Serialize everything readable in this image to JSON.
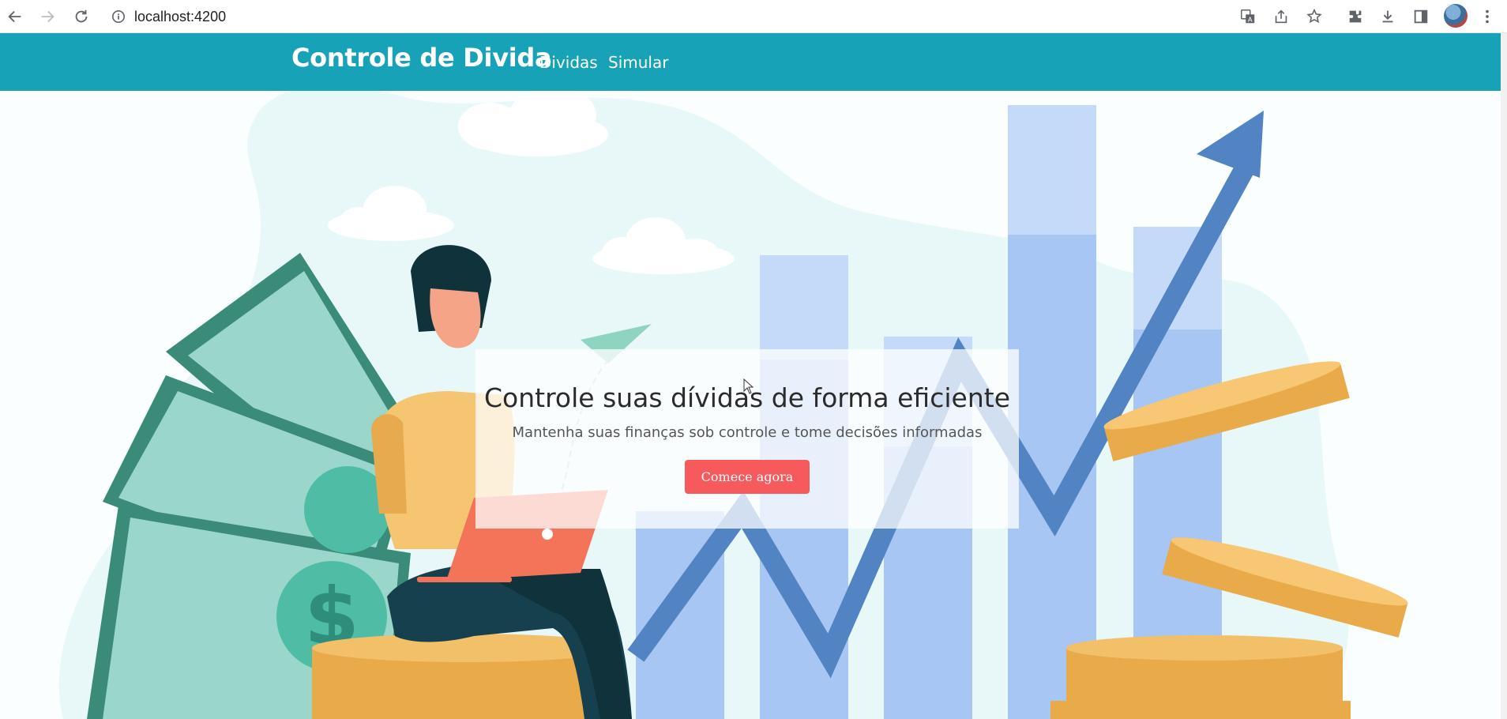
{
  "browser": {
    "url": "localhost:4200",
    "icons": [
      "back-icon",
      "forward-icon",
      "reload-icon",
      "info-icon",
      "translate-icon",
      "share-icon",
      "star-icon",
      "extensions-icon",
      "download-icon",
      "side-panel-icon",
      "profile-avatar",
      "menu-icon"
    ]
  },
  "navbar": {
    "brand": "Controle de Divida",
    "links": [
      "Dividas",
      "Simular"
    ],
    "color": "#18a2b8"
  },
  "hero": {
    "title": "Controle suas dívidas de forma eficiente",
    "subtitle": "Mantenha suas finanças sob controle e tome decisões informadas",
    "cta_label": "Comece agora",
    "cta_color": "#f75a5c"
  }
}
